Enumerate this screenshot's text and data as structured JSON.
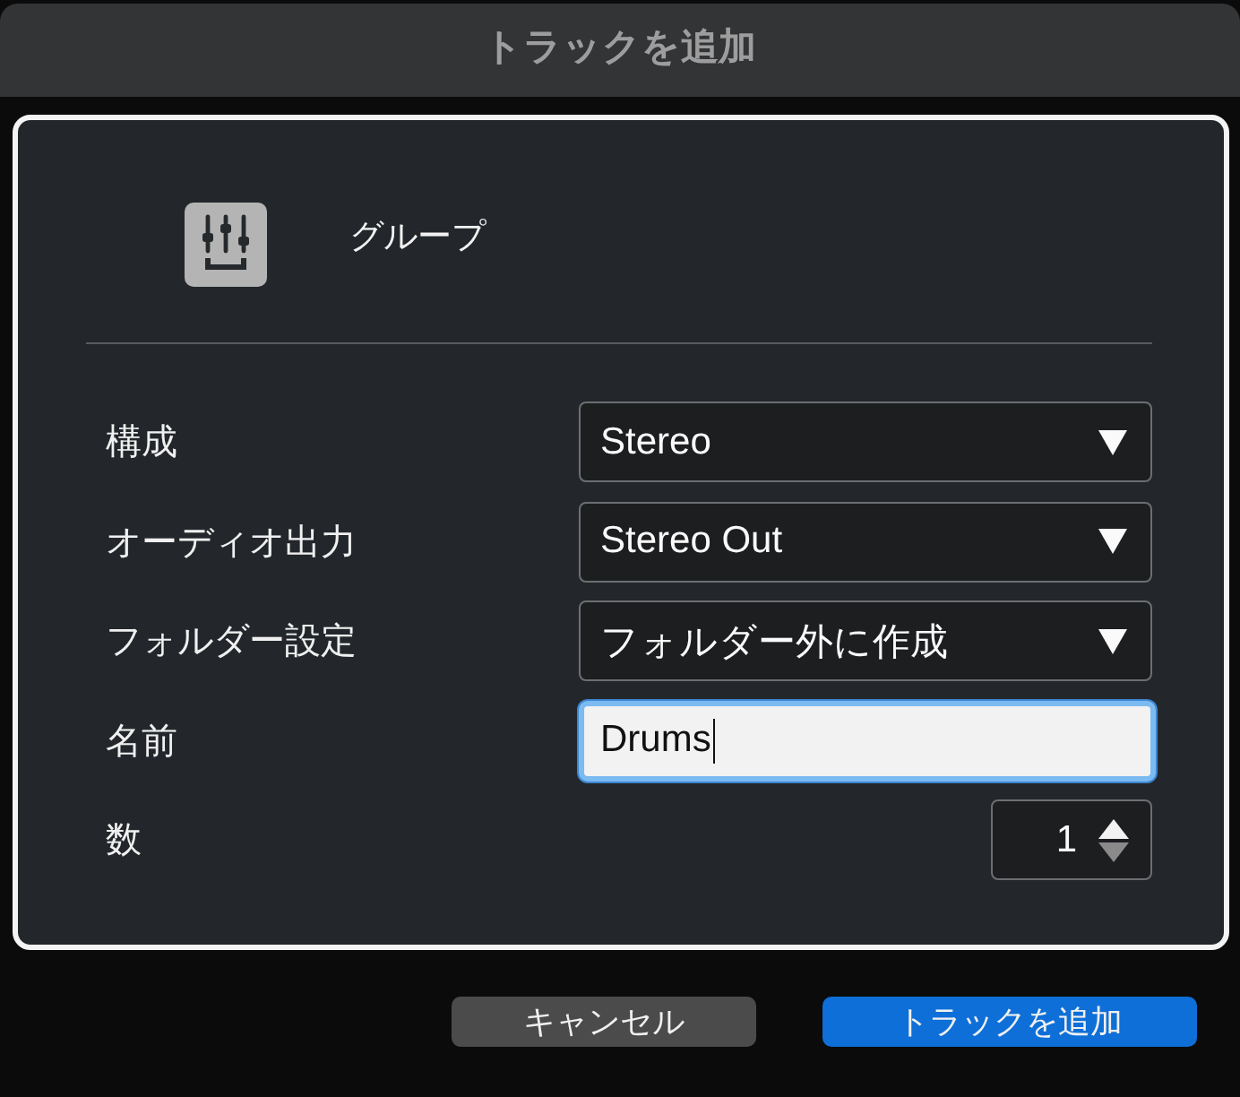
{
  "window": {
    "title": "トラックを追加"
  },
  "track_type": {
    "label": "グループ"
  },
  "settings": [
    {
      "kind": "dropdown",
      "label": "構成",
      "value": "Stereo"
    },
    {
      "kind": "dropdown",
      "label": "オーディオ出力",
      "value": "Stereo Out"
    },
    {
      "kind": "dropdown",
      "label": "フォルダー設定",
      "value": "フォルダー外に作成"
    },
    {
      "kind": "text",
      "label": "名前",
      "value": "Drums",
      "focused": true
    },
    {
      "kind": "spinner",
      "label": "数",
      "value": "1",
      "decrement_disabled": true
    }
  ],
  "buttons": [
    {
      "label": "キャンセル",
      "kind": "secondary"
    },
    {
      "label": "トラックを追加",
      "kind": "primary"
    }
  ]
}
